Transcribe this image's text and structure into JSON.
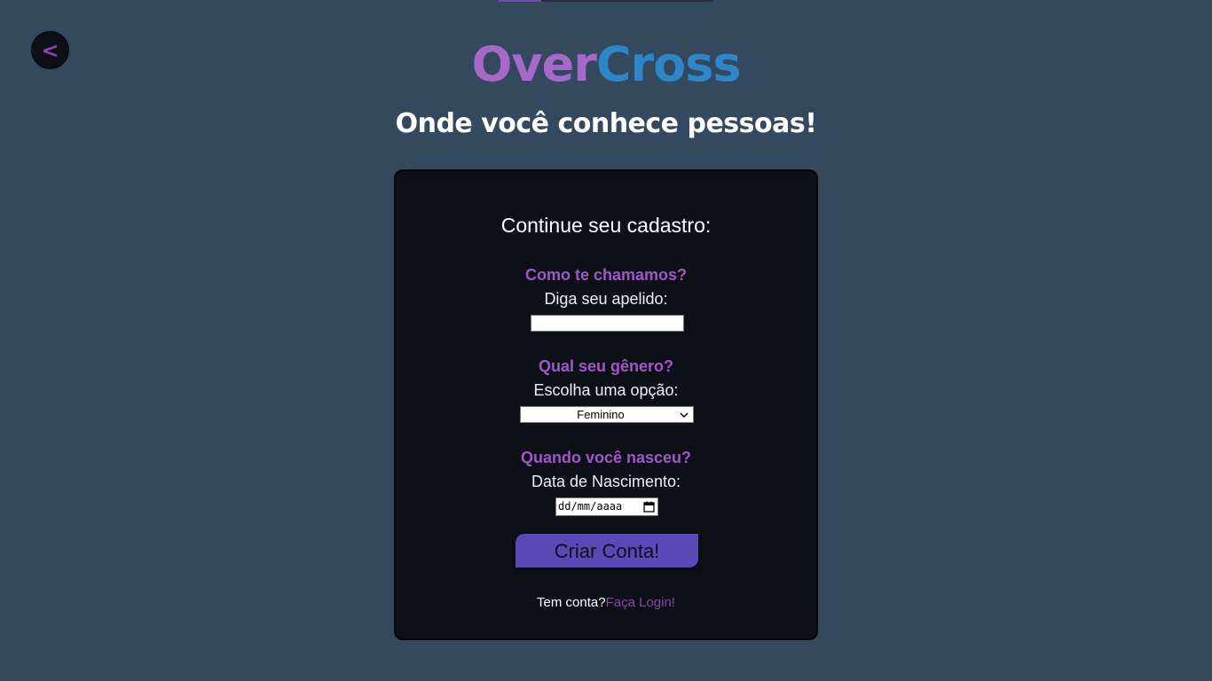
{
  "progress": {
    "fraction": 0.2,
    "fill_color": "#6f4bb0"
  },
  "back_button": {
    "label": "<"
  },
  "header": {
    "logo_part1": "Over",
    "logo_part2": "Cross",
    "logo_color1": "#a56ac9",
    "logo_color2": "#2e86c8",
    "tagline": "Onde você conhece pessoas!"
  },
  "form": {
    "title": "Continue seu cadastro:",
    "nickname": {
      "heading": "Como te chamamos?",
      "label": "Diga seu apelido:",
      "value": ""
    },
    "gender": {
      "heading": "Qual seu gênero?",
      "label": "Escolha uma opção:",
      "selected": "Feminino",
      "chevron_icon": "chevron-down-icon"
    },
    "birthdate": {
      "heading": "Quando você nasceu?",
      "label": "Data de Nascimento:",
      "placeholder": "dd/mm/aaaa",
      "calendar_icon": "calendar-icon"
    },
    "submit_label": "Criar Conta!",
    "submit_color": "#5b48b8",
    "login_prompt": "Tem conta?",
    "login_link": "Faça Login!"
  }
}
